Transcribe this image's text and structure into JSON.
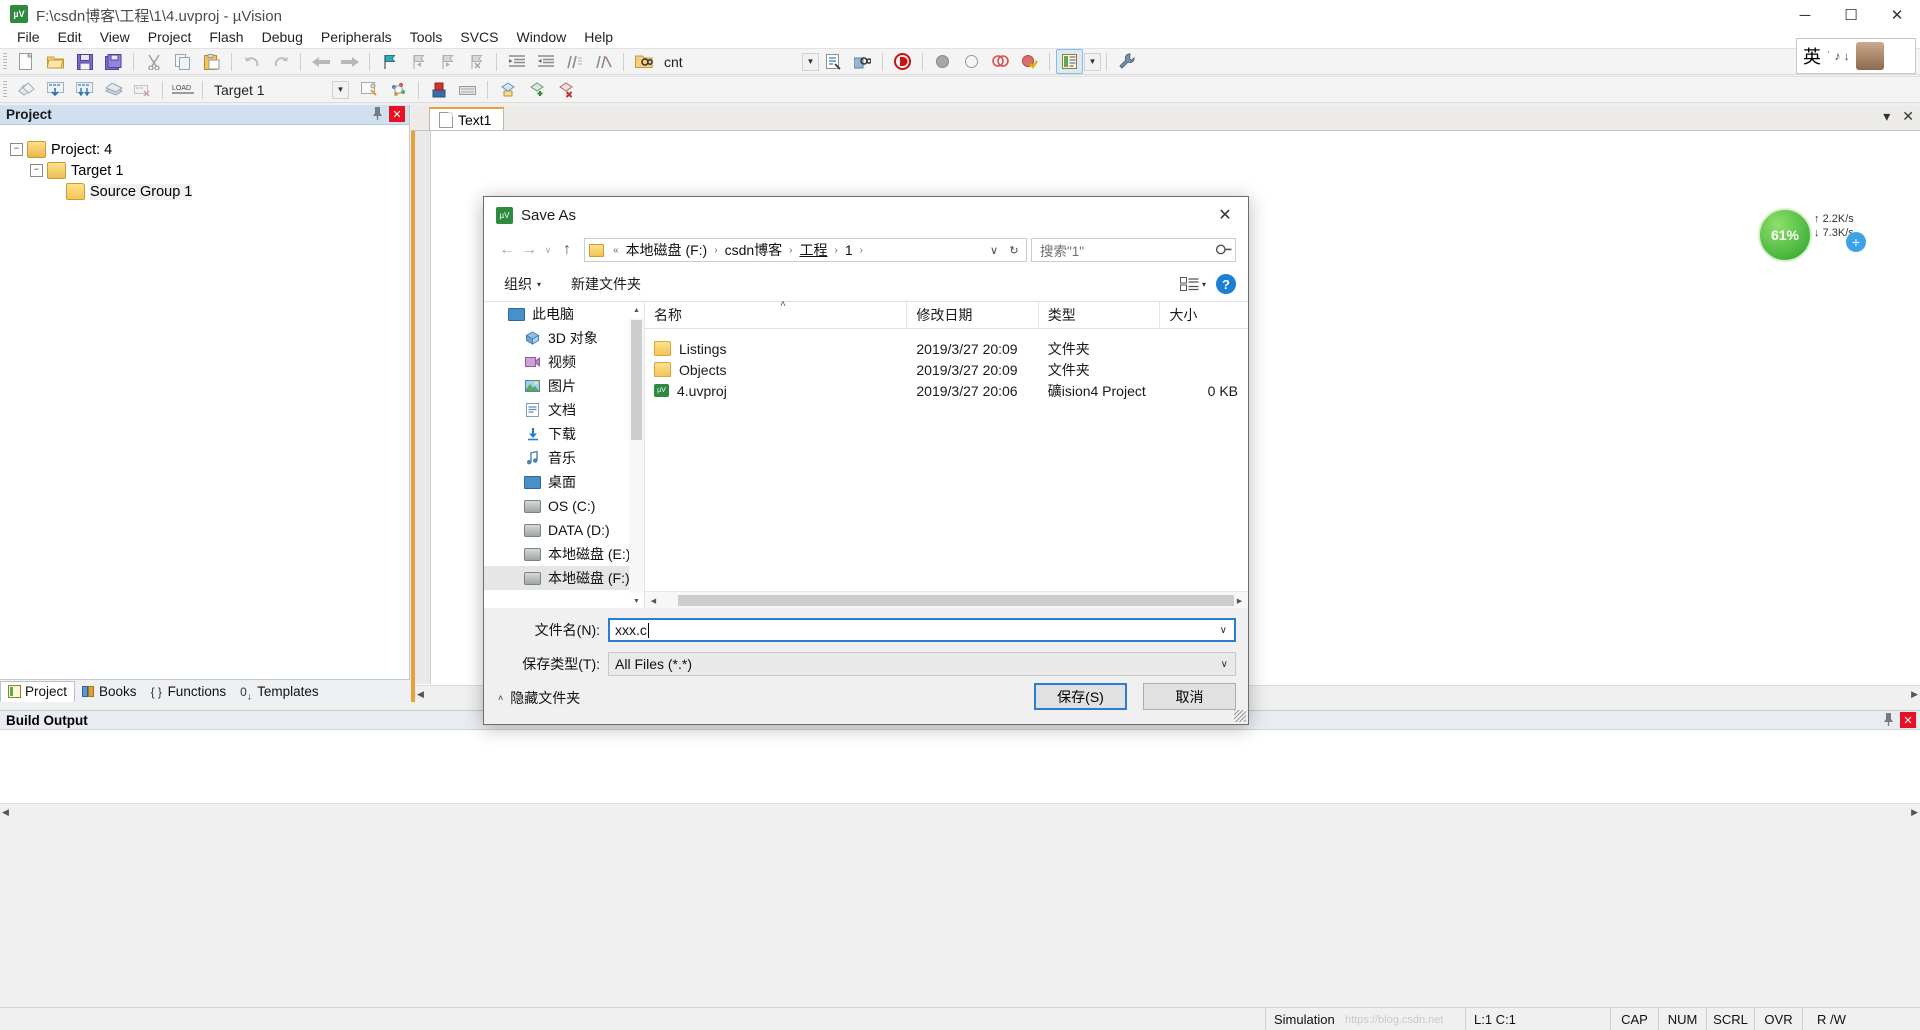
{
  "window": {
    "title": "F:\\csdn博客\\工程\\1\\4.uvproj - µVision",
    "icon": "uvision-icon",
    "minimize": "─",
    "maximize": "☐",
    "close": "✕"
  },
  "menu": {
    "items": [
      "File",
      "Edit",
      "View",
      "Project",
      "Flash",
      "Debug",
      "Peripherals",
      "Tools",
      "SVCS",
      "Window",
      "Help"
    ]
  },
  "toolbar1": {
    "buttons": [
      {
        "name": "new-file-icon",
        "glyph": "὜B"
      },
      {
        "name": "open-file-icon",
        "glyph": "Ὄ2"
      },
      {
        "name": "save-icon",
        "glyph": "ὋE"
      },
      {
        "name": "save-all-icon",
        "glyph": "὚B"
      },
      {
        "name": "cut-icon",
        "glyph": "✂"
      },
      {
        "name": "copy-icon",
        "glyph": "Ὄ4"
      },
      {
        "name": "paste-icon",
        "glyph": "ὌB"
      },
      {
        "name": "undo-icon",
        "glyph": "↶"
      },
      {
        "name": "redo-icon",
        "glyph": "↷"
      },
      {
        "name": "navigate-back-icon",
        "glyph": "←"
      },
      {
        "name": "navigate-forward-icon",
        "glyph": "→"
      },
      {
        "name": "bookmark-toggle-icon",
        "glyph": "⚑"
      },
      {
        "name": "bookmark-prev-icon",
        "glyph": "⚑"
      },
      {
        "name": "bookmark-next-icon",
        "glyph": "⚑"
      },
      {
        "name": "bookmark-clear-icon",
        "glyph": "⚑"
      },
      {
        "name": "indent-icon",
        "glyph": "⇥"
      },
      {
        "name": "outdent-icon",
        "glyph": "⇤"
      },
      {
        "name": "comment-icon",
        "glyph": "//"
      },
      {
        "name": "uncomment-icon",
        "glyph": "//"
      },
      {
        "name": "find-in-files-icon",
        "glyph": "ὐD"
      }
    ],
    "search_value": "cnt",
    "right_buttons": [
      {
        "name": "incremental-find-icon",
        "glyph": "Ὓ9"
      },
      {
        "name": "find-icon",
        "glyph": "ὐE"
      },
      {
        "name": "debug-icon",
        "glyph": "Ⓓ"
      },
      {
        "name": "breakpoint-icon",
        "glyph": "●"
      },
      {
        "name": "breakpoint-disable-icon",
        "glyph": "○"
      },
      {
        "name": "breakpoint-kill-all-icon",
        "glyph": "◎"
      },
      {
        "name": "breakpoint-clear-icon",
        "glyph": "◉"
      },
      {
        "name": "project-window-icon",
        "glyph": "὜2"
      },
      {
        "name": "configure-icon",
        "glyph": "ὒ7"
      }
    ]
  },
  "toolbar2": {
    "buttons": [
      {
        "name": "build-icon",
        "glyph": "◆"
      },
      {
        "name": "rebuild-icon",
        "glyph": "▦"
      },
      {
        "name": "batch-build-icon",
        "glyph": "▦"
      },
      {
        "name": "translate-icon",
        "glyph": "▓"
      },
      {
        "name": "stop-build-icon",
        "glyph": "▒"
      },
      {
        "name": "download-icon",
        "glyph": "LOAD"
      }
    ],
    "target_value": "Target 1",
    "right_buttons": [
      {
        "name": "target-options-icon",
        "glyph": "▢"
      },
      {
        "name": "manage-components-icon",
        "glyph": "✦"
      },
      {
        "name": "pack-installer-icon",
        "glyph": "Ὦ2"
      },
      {
        "name": "manage-run-env-icon",
        "glyph": "⌸"
      },
      {
        "name": "multi-project-icon",
        "glyph": "◇"
      },
      {
        "name": "new-target-icon",
        "glyph": "◈"
      },
      {
        "name": "remove-target-icon",
        "glyph": "◆"
      }
    ]
  },
  "project_panel": {
    "title": "Project",
    "pin": "ὌC",
    "close": "✕",
    "tree": [
      {
        "label": "Project: 4",
        "icon": "project-icon",
        "expander": "−",
        "level": 0
      },
      {
        "label": "Target 1",
        "icon": "target-icon",
        "expander": "−",
        "level": 1
      },
      {
        "label": "Source Group 1",
        "icon": "folder-icon",
        "expander": "",
        "level": 2
      }
    ],
    "tabs": [
      {
        "label": "Project",
        "icon": "project-tab-icon",
        "selected": true
      },
      {
        "label": "Books",
        "icon": "books-tab-icon",
        "selected": false
      },
      {
        "label": "Functions",
        "icon": "functions-tab-icon",
        "selected": false
      },
      {
        "label": "Templates",
        "icon": "templates-tab-icon",
        "selected": false
      }
    ]
  },
  "editor": {
    "tab_label": "Text1",
    "tab_icon": "document-icon",
    "minimize": "▾",
    "close": "✕"
  },
  "build_output": {
    "title": "Build Output",
    "pin": "ὌC",
    "close": "✕",
    "content": ""
  },
  "status_bar": {
    "simulation": "Simulation",
    "position": "L:1 C:1",
    "flags": [
      "CAP",
      "NUM",
      "SCRL",
      "OVR",
      "R /W"
    ]
  },
  "net_widget": {
    "percent": "61%",
    "upload": "2.2K/s",
    "download": "7.3K/s",
    "up_arrow": "↑",
    "down_arrow": "↓",
    "plus": "+"
  },
  "ime": {
    "lang": "英",
    "marks": "˙ ♪ ↓"
  },
  "watermark": "https://blog.csdn.net",
  "dialog": {
    "title": "Save As",
    "icon": "uvision-icon",
    "close": "✕",
    "nav": {
      "back": "←",
      "forward": "→",
      "recent": "∨",
      "up": "↑",
      "breadcrumb_prefix": "«",
      "breadcrumbs": [
        "本地磁盘 (F:)",
        "csdn博客",
        "工程",
        "1"
      ],
      "separator": "›",
      "dropdown": "∨",
      "refresh": "↻"
    },
    "search": {
      "placeholder": "搜索\"1\"",
      "icon": "search-icon"
    },
    "commands": {
      "organize": "组织",
      "organize_caret": "▾",
      "new_folder": "新建文件夹",
      "view_icon": "view-layout-icon",
      "view_caret": "▾",
      "help": "?"
    },
    "nav_pane": {
      "items": [
        {
          "label": "此电脑",
          "icon": "computer-icon",
          "level": 1,
          "selected": false
        },
        {
          "label": "3D 对象",
          "icon": "3d-objects-icon",
          "level": 2,
          "selected": false
        },
        {
          "label": "视频",
          "icon": "videos-icon",
          "level": 2,
          "selected": false
        },
        {
          "label": "图片",
          "icon": "pictures-icon",
          "level": 2,
          "selected": false
        },
        {
          "label": "文档",
          "icon": "documents-icon",
          "level": 2,
          "selected": false
        },
        {
          "label": "下载",
          "icon": "downloads-icon",
          "level": 2,
          "selected": false
        },
        {
          "label": "音乐",
          "icon": "music-icon",
          "level": 2,
          "selected": false
        },
        {
          "label": "桌面",
          "icon": "desktop-icon",
          "level": 2,
          "selected": false
        },
        {
          "label": "OS (C:)",
          "icon": "drive-icon",
          "level": 2,
          "selected": false
        },
        {
          "label": "DATA (D:)",
          "icon": "drive-icon",
          "level": 2,
          "selected": false
        },
        {
          "label": "本地磁盘 (E:)",
          "icon": "drive-icon",
          "level": 2,
          "selected": false
        },
        {
          "label": "本地磁盘 (F:)",
          "icon": "drive-icon",
          "level": 2,
          "selected": true
        }
      ],
      "scroll_up": "▲",
      "scroll_down": "▼"
    },
    "file_list": {
      "columns": [
        "名称",
        "修改日期",
        "类型",
        "大小"
      ],
      "sort_indicator": "˄",
      "rows": [
        {
          "name": "Listings",
          "modified": "2019/3/27 20:09",
          "type": "文件夹",
          "size": "",
          "icon": "folder-icon"
        },
        {
          "name": "Objects",
          "modified": "2019/3/27 20:09",
          "type": "文件夹",
          "size": "",
          "icon": "folder-icon"
        },
        {
          "name": "4.uvproj",
          "modified": "2019/3/27 20:06",
          "type": "礦ision4 Project",
          "size": "0 KB",
          "icon": "uvproj-icon"
        }
      ],
      "scroll_left": "◀",
      "scroll_right": "▶"
    },
    "form": {
      "filename_label": "文件名(N):",
      "filename_value": "xxx.c",
      "filetype_label": "保存类型(T):",
      "filetype_value": "All Files (*.*)",
      "dropdown_caret": "∨",
      "hide_folders": "隐藏文件夹",
      "hide_caret": "˄",
      "save_button": "保存(S)",
      "cancel_button": "取消"
    }
  }
}
